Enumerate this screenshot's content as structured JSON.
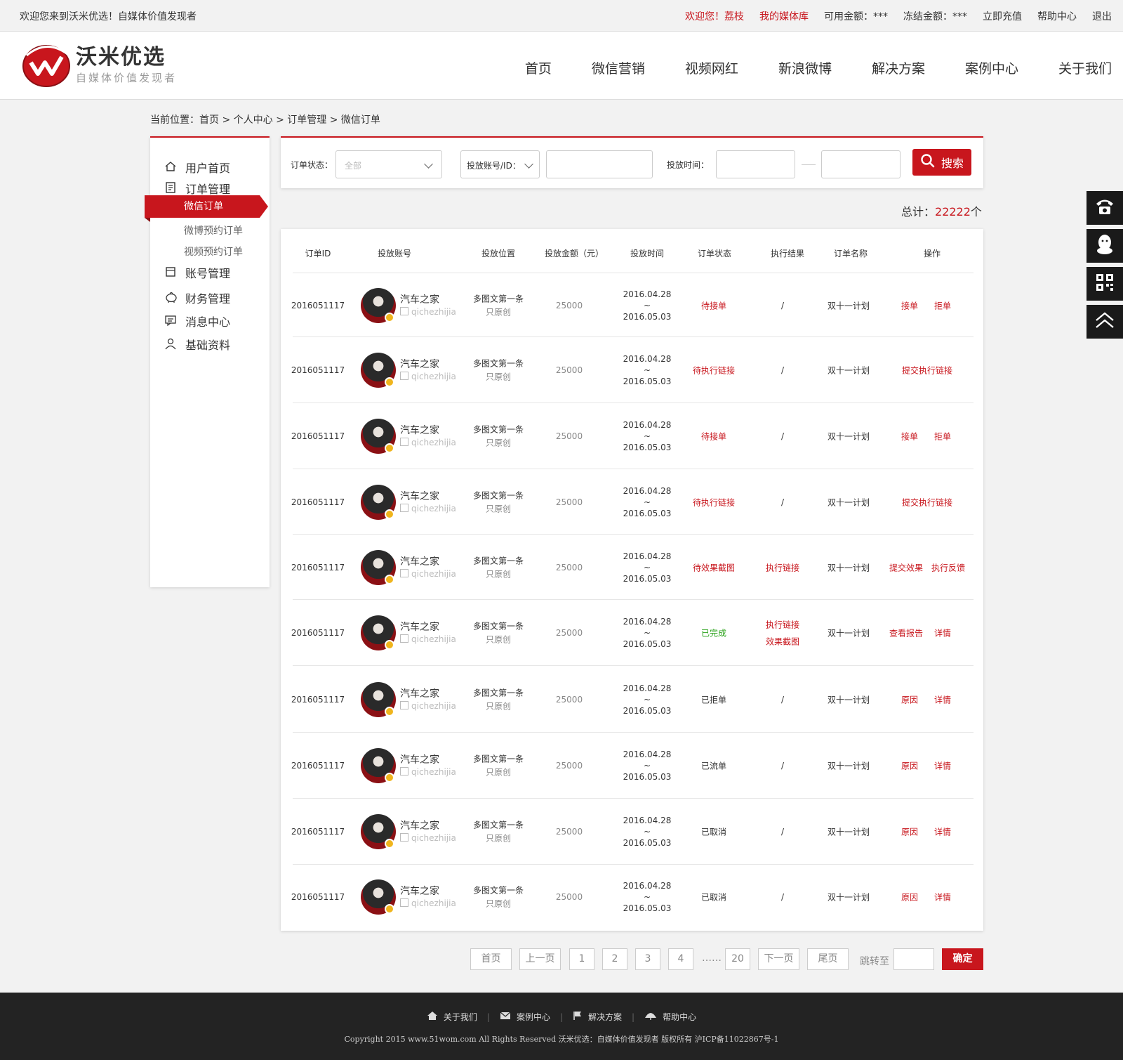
{
  "topbar": {
    "welcome": "欢迎您来到沃米优选！自媒体价值发现者",
    "greeting": "欢迎您！荔枝",
    "media_lib": "我的媒体库",
    "available": "可用金额：***",
    "frozen": "冻结金额：***",
    "recharge": "立即充值",
    "help": "帮助中心",
    "logout": "退出"
  },
  "logo": {
    "title": "沃米优选",
    "subtitle": "自媒体价值发现者"
  },
  "nav": [
    "首页",
    "微信营销",
    "视频网红",
    "新浪微博",
    "解决方案",
    "案例中心",
    "关于我们"
  ],
  "breadcrumb": "当前位置：首页 > 个人中心 > 订单管理 > 微信订单",
  "sidebar": {
    "home": "用户首页",
    "orders": "订单管理",
    "wechat_orders": "微信订单",
    "weibo_orders": "微博预约订单",
    "video_orders": "视频预约订单",
    "accounts": "账号管理",
    "finance": "财务管理",
    "messages": "消息中心",
    "profile": "基础资料"
  },
  "filter": {
    "status_label": "订单状态：",
    "status_placeholder": "全部",
    "account_select": "投放账号/ID：",
    "time_label": "投放时间：",
    "search": "搜索"
  },
  "total": {
    "label": "总计：",
    "count": "22222",
    "unit": "个"
  },
  "table": {
    "headers": [
      "订单ID",
      "投放账号",
      "投放位置",
      "投放金额（元）",
      "投放时间",
      "订单状态",
      "执行结果",
      "订单名称",
      "操作"
    ],
    "rows": [
      {
        "id": "2016051117",
        "name": "汽车之家",
        "handle": "qichezhijia",
        "pos1": "多图文第一条",
        "pos2": "只原创",
        "amount": "25000",
        "date1": "2016.04.28",
        "tilde": "~",
        "date2": "2016.05.03",
        "status": "待接单",
        "result": "/",
        "result2": "",
        "title": "双十一计划",
        "action1": "接单",
        "action2": "拒单"
      },
      {
        "id": "2016051117",
        "name": "汽车之家",
        "handle": "qichezhijia",
        "pos1": "多图文第一条",
        "pos2": "只原创",
        "amount": "25000",
        "date1": "2016.04.28",
        "tilde": "~",
        "date2": "2016.05.03",
        "status": "待执行链接",
        "result": "/",
        "result2": "",
        "title": "双十一计划",
        "action1": "提交执行链接",
        "action2": ""
      },
      {
        "id": "2016051117",
        "name": "汽车之家",
        "handle": "qichezhijia",
        "pos1": "多图文第一条",
        "pos2": "只原创",
        "amount": "25000",
        "date1": "2016.04.28",
        "tilde": "~",
        "date2": "2016.05.03",
        "status": "待接单",
        "result": "/",
        "result2": "",
        "title": "双十一计划",
        "action1": "接单",
        "action2": "拒单"
      },
      {
        "id": "2016051117",
        "name": "汽车之家",
        "handle": "qichezhijia",
        "pos1": "多图文第一条",
        "pos2": "只原创",
        "amount": "25000",
        "date1": "2016.04.28",
        "tilde": "~",
        "date2": "2016.05.03",
        "status": "待执行链接",
        "result": "/",
        "result2": "",
        "title": "双十一计划",
        "action1": "提交执行链接",
        "action2": ""
      },
      {
        "id": "2016051117",
        "name": "汽车之家",
        "handle": "qichezhijia",
        "pos1": "多图文第一条",
        "pos2": "只原创",
        "amount": "25000",
        "date1": "2016.04.28",
        "tilde": "~",
        "date2": "2016.05.03",
        "status": "待效果截图",
        "result": "执行链接",
        "result2": "",
        "title": "双十一计划",
        "action1": "提交效果",
        "action2": "执行反馈"
      },
      {
        "id": "2016051117",
        "name": "汽车之家",
        "handle": "qichezhijia",
        "pos1": "多图文第一条",
        "pos2": "只原创",
        "amount": "25000",
        "date1": "2016.04.28",
        "tilde": "~",
        "date2": "2016.05.03",
        "status": "已完成",
        "result": "执行链接",
        "result2": "效果截图",
        "title": "双十一计划",
        "action1": "查看报告",
        "action2": "详情"
      },
      {
        "id": "2016051117",
        "name": "汽车之家",
        "handle": "qichezhijia",
        "pos1": "多图文第一条",
        "pos2": "只原创",
        "amount": "25000",
        "date1": "2016.04.28",
        "tilde": "~",
        "date2": "2016.05.03",
        "status": "已拒单",
        "result": "/",
        "result2": "",
        "title": "双十一计划",
        "action1": "原因",
        "action2": "详情"
      },
      {
        "id": "2016051117",
        "name": "汽车之家",
        "handle": "qichezhijia",
        "pos1": "多图文第一条",
        "pos2": "只原创",
        "amount": "25000",
        "date1": "2016.04.28",
        "tilde": "~",
        "date2": "2016.05.03",
        "status": "已流单",
        "result": "/",
        "result2": "",
        "title": "双十一计划",
        "action1": "原因",
        "action2": "详情"
      },
      {
        "id": "2016051117",
        "name": "汽车之家",
        "handle": "qichezhijia",
        "pos1": "多图文第一条",
        "pos2": "只原创",
        "amount": "25000",
        "date1": "2016.04.28",
        "tilde": "~",
        "date2": "2016.05.03",
        "status": "已取消",
        "result": "/",
        "result2": "",
        "title": "双十一计划",
        "action1": "原因",
        "action2": "详情"
      },
      {
        "id": "2016051117",
        "name": "汽车之家",
        "handle": "qichezhijia",
        "pos1": "多图文第一条",
        "pos2": "只原创",
        "amount": "25000",
        "date1": "2016.04.28",
        "tilde": "~",
        "date2": "2016.05.03",
        "status": "已取消",
        "result": "/",
        "result2": "",
        "title": "双十一计划",
        "action1": "原因",
        "action2": "详情"
      }
    ]
  },
  "pager": {
    "first": "首页",
    "prev": "上一页",
    "pages": [
      "1",
      "2",
      "3",
      "4"
    ],
    "dots": "……",
    "last_page": "20",
    "next": "下一页",
    "last": "尾页",
    "jump": "跳转至",
    "ok": "确定"
  },
  "footer": {
    "links": [
      "关于我们",
      "案例中心",
      "解决方案",
      "帮助中心"
    ],
    "copyright": "Copyright 2015 www.51wom.com All Rights Reserved 沃米优选：自媒体价值发现者 版权所有 沪ICP备11022867号-1"
  },
  "colors": {
    "accent": "#c8161d",
    "success": "#2aa21a",
    "footer_bg": "#232323"
  },
  "float_icons": [
    "phone-icon",
    "qq-icon",
    "qrcode-icon",
    "back-to-top-icon"
  ]
}
